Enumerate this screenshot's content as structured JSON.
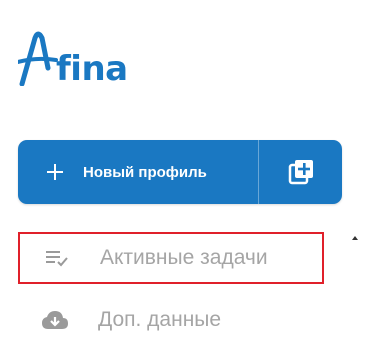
{
  "brand": {
    "logo_text": "fina",
    "color": "#1a78c2"
  },
  "new_profile_button": {
    "label": "Новый профиль",
    "icon": "plus-icon",
    "extra_icon": "add-box-icon"
  },
  "menu": {
    "items": [
      {
        "label": "Активные задачи",
        "icon": "playlist-check-icon",
        "highlighted": true
      },
      {
        "label": "Доп. данные",
        "icon": "cloud-download-icon",
        "highlighted": false
      }
    ]
  },
  "colors": {
    "accent": "#1a78c2",
    "highlight_border": "#e0202a",
    "menu_text": "#a5a5a5"
  }
}
